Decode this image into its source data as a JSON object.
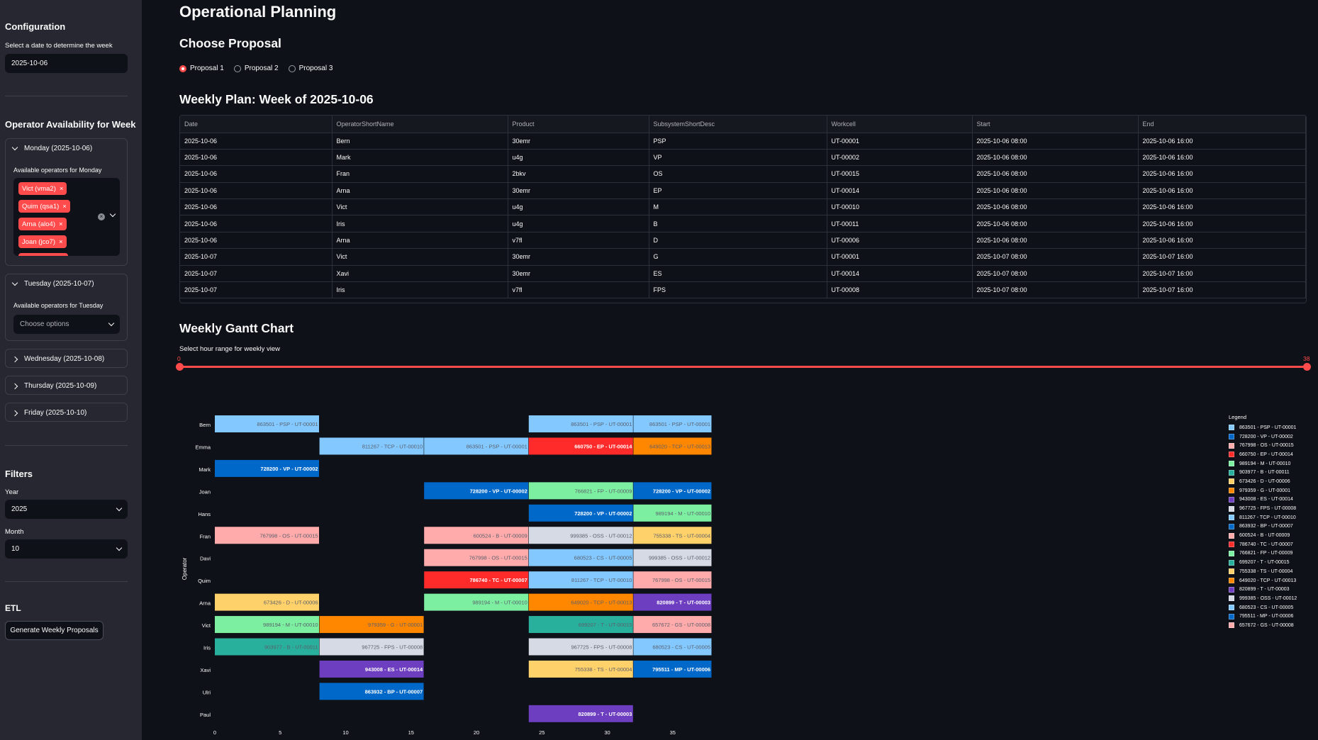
{
  "sidebar": {
    "config_title": "Configuration",
    "date_label": "Select a date to determine the week",
    "date_value": "2025-10-06",
    "avail_title": "Operator Availability for Week",
    "monday": {
      "header": "Monday (2025-10-06)",
      "label": "Available operators for Monday",
      "tags": [
        "Vict (vma2)",
        "Quim (qsa1)",
        "Arna (alo4)",
        "Joan (jco7)"
      ]
    },
    "tuesday": {
      "header": "Tuesday (2025-10-07)",
      "label": "Available operators for Tuesday",
      "placeholder": "Choose options"
    },
    "wednesday": "Wednesday (2025-10-08)",
    "thursday": "Thursday (2025-10-09)",
    "friday": "Friday (2025-10-10)",
    "filters_title": "Filters",
    "year_label": "Year",
    "year_value": "2025",
    "month_label": "Month",
    "month_value": "10",
    "etl_title": "ETL",
    "etl_button": "Generate Weekly Proposals"
  },
  "main": {
    "title": "Operational Planning",
    "proposal_title": "Choose Proposal",
    "proposals": [
      "Proposal 1",
      "Proposal 2",
      "Proposal 3"
    ],
    "selected_proposal": "Proposal 1",
    "plan_title": "Weekly Plan: Week of 2025-10-06",
    "gantt_title": "Weekly Gantt Chart",
    "slider_label": "Select hour range for weekly view",
    "slider_min": "0",
    "slider_max": "38"
  },
  "table": {
    "columns": [
      "Date",
      "OperatorShortName",
      "Product",
      "SubsystemShortDesc",
      "Workcell",
      "Start",
      "End"
    ],
    "rows": [
      [
        "2025-10-06",
        "Bern",
        "30emr",
        "PSP",
        "UT-00001",
        "2025-10-06 08:00",
        "2025-10-06 16:00"
      ],
      [
        "2025-10-06",
        "Mark",
        "u4g",
        "VP",
        "UT-00002",
        "2025-10-06 08:00",
        "2025-10-06 16:00"
      ],
      [
        "2025-10-06",
        "Fran",
        "2bkv",
        "OS",
        "UT-00015",
        "2025-10-06 08:00",
        "2025-10-06 16:00"
      ],
      [
        "2025-10-06",
        "Arna",
        "30emr",
        "EP",
        "UT-00014",
        "2025-10-06 08:00",
        "2025-10-06 16:00"
      ],
      [
        "2025-10-06",
        "Vict",
        "u4g",
        "M",
        "UT-00010",
        "2025-10-06 08:00",
        "2025-10-06 16:00"
      ],
      [
        "2025-10-06",
        "Iris",
        "u4g",
        "B",
        "UT-00011",
        "2025-10-06 08:00",
        "2025-10-06 16:00"
      ],
      [
        "2025-10-06",
        "Arna",
        "v7fl",
        "D",
        "UT-00006",
        "2025-10-06 08:00",
        "2025-10-06 16:00"
      ],
      [
        "2025-10-07",
        "Vict",
        "30emr",
        "G",
        "UT-00001",
        "2025-10-07 08:00",
        "2025-10-07 16:00"
      ],
      [
        "2025-10-07",
        "Xavi",
        "30emr",
        "ES",
        "UT-00014",
        "2025-10-07 08:00",
        "2025-10-07 16:00"
      ],
      [
        "2025-10-07",
        "Iris",
        "v7fl",
        "FPS",
        "UT-00008",
        "2025-10-07 08:00",
        "2025-10-07 16:00"
      ]
    ]
  },
  "colors": {
    "accent": "#ff4b4b",
    "background": "#0e1117",
    "sidebar": "#262730"
  },
  "chart_data": {
    "type": "gantt",
    "ylabel": "Operator",
    "xlim": [
      0,
      38
    ],
    "xticks": [
      0,
      5,
      10,
      15,
      20,
      25,
      30,
      35
    ],
    "operators": [
      "Bern",
      "Emma",
      "Mark",
      "Joan",
      "Hans",
      "Fran",
      "Davi",
      "Quim",
      "Arna",
      "Vict",
      "Iris",
      "Xavi",
      "Ulri",
      "Paul"
    ],
    "legend_title": "Legend",
    "legend": [
      {
        "label": "863501 - PSP - UT-00001",
        "color": "#83c9ff"
      },
      {
        "label": "728200 - VP - UT-00002",
        "color": "#0068c9"
      },
      {
        "label": "767998 - OS - UT-00015",
        "color": "#ffabab"
      },
      {
        "label": "660750 - EP - UT-00014",
        "color": "#ff2b2b"
      },
      {
        "label": "989194 - M - UT-00010",
        "color": "#7defa1"
      },
      {
        "label": "903977 - B - UT-00011",
        "color": "#29b09d"
      },
      {
        "label": "673426 - D - UT-00006",
        "color": "#ffd16a"
      },
      {
        "label": "979359 - G - UT-00001",
        "color": "#ff8700"
      },
      {
        "label": "943008 - ES - UT-00014",
        "color": "#6d3fc0"
      },
      {
        "label": "967725 - FPS - UT-00008",
        "color": "#d5dae5"
      },
      {
        "label": "811267 - TCP - UT-00010",
        "color": "#83c9ff"
      },
      {
        "label": "863932 - BP - UT-00007",
        "color": "#0068c9"
      },
      {
        "label": "600524 - B - UT-00009",
        "color": "#ffabab"
      },
      {
        "label": "786740 - TC - UT-00007",
        "color": "#ff2b2b"
      },
      {
        "label": "766821 - FP - UT-00009",
        "color": "#7defa1"
      },
      {
        "label": "699207 - T - UT-00015",
        "color": "#29b09d"
      },
      {
        "label": "755338 - TS - UT-00004",
        "color": "#ffd16a"
      },
      {
        "label": "649020 - TCP - UT-00013",
        "color": "#ff8700"
      },
      {
        "label": "820899 - T - UT-00003",
        "color": "#6d3fc0"
      },
      {
        "label": "999385 - OSS - UT-00012",
        "color": "#d5dae5"
      },
      {
        "label": "680523 - CS - UT-00005",
        "color": "#83c9ff"
      },
      {
        "label": "795511 - MP - UT-00006",
        "color": "#0068c9"
      },
      {
        "label": "657672 - GS - UT-00008",
        "color": "#ffabab"
      }
    ],
    "tasks": [
      {
        "op": "Bern",
        "start": 0,
        "end": 8,
        "label": "863501 - PSP - UT-00001"
      },
      {
        "op": "Bern",
        "start": 24,
        "end": 32,
        "label": "863501 - PSP - UT-00001"
      },
      {
        "op": "Bern",
        "start": 32,
        "end": 38,
        "label": "863501 - PSP - UT-00001"
      },
      {
        "op": "Emma",
        "start": 8,
        "end": 16,
        "label": "811267 - TCP - UT-00010"
      },
      {
        "op": "Emma",
        "start": 16,
        "end": 24,
        "label": "863501 - PSP - UT-00001"
      },
      {
        "op": "Emma",
        "start": 24,
        "end": 32,
        "label": "660750 - EP - UT-00014"
      },
      {
        "op": "Emma",
        "start": 32,
        "end": 38,
        "label": "649020 - TCP - UT-00013"
      },
      {
        "op": "Mark",
        "start": 0,
        "end": 8,
        "label": "728200 - VP - UT-00002"
      },
      {
        "op": "Joan",
        "start": 16,
        "end": 24,
        "label": "728200 - VP - UT-00002"
      },
      {
        "op": "Joan",
        "start": 24,
        "end": 32,
        "label": "766821 - FP - UT-00009"
      },
      {
        "op": "Joan",
        "start": 32,
        "end": 38,
        "label": "728200 - VP - UT-00002"
      },
      {
        "op": "Hans",
        "start": 24,
        "end": 32,
        "label": "728200 - VP - UT-00002"
      },
      {
        "op": "Hans",
        "start": 32,
        "end": 38,
        "label": "989194 - M - UT-00010"
      },
      {
        "op": "Fran",
        "start": 0,
        "end": 8,
        "label": "767998 - OS - UT-00015"
      },
      {
        "op": "Fran",
        "start": 16,
        "end": 24,
        "label": "600524 - B - UT-00009"
      },
      {
        "op": "Fran",
        "start": 24,
        "end": 32,
        "label": "999385 - OSS - UT-00012"
      },
      {
        "op": "Fran",
        "start": 32,
        "end": 38,
        "label": "755338 - TS - UT-00004"
      },
      {
        "op": "Davi",
        "start": 16,
        "end": 24,
        "label": "767998 - OS - UT-00015"
      },
      {
        "op": "Davi",
        "start": 24,
        "end": 32,
        "label": "680523 - CS - UT-00005"
      },
      {
        "op": "Davi",
        "start": 32,
        "end": 38,
        "label": "999385 - OSS - UT-00012"
      },
      {
        "op": "Quim",
        "start": 16,
        "end": 24,
        "label": "786740 - TC - UT-00007"
      },
      {
        "op": "Quim",
        "start": 24,
        "end": 32,
        "label": "811267 - TCP - UT-00010"
      },
      {
        "op": "Quim",
        "start": 32,
        "end": 38,
        "label": "767998 - OS - UT-00015"
      },
      {
        "op": "Arna",
        "start": 0,
        "end": 8,
        "label": "673426 - D - UT-00006"
      },
      {
        "op": "Arna",
        "start": 16,
        "end": 24,
        "label": "989194 - M - UT-00010"
      },
      {
        "op": "Arna",
        "start": 24,
        "end": 32,
        "label": "649020 - TCP - UT-00013"
      },
      {
        "op": "Arna",
        "start": 32,
        "end": 38,
        "label": "820899 - T - UT-00003"
      },
      {
        "op": "Vict",
        "start": 0,
        "end": 8,
        "label": "989194 - M - UT-00010"
      },
      {
        "op": "Vict",
        "start": 8,
        "end": 16,
        "label": "979359 - G - UT-00001"
      },
      {
        "op": "Vict",
        "start": 24,
        "end": 32,
        "label": "699207 - T - UT-00015"
      },
      {
        "op": "Vict",
        "start": 32,
        "end": 38,
        "label": "657672 - GS - UT-00008"
      },
      {
        "op": "Iris",
        "start": 0,
        "end": 8,
        "label": "903977 - B - UT-00011"
      },
      {
        "op": "Iris",
        "start": 8,
        "end": 16,
        "label": "967725 - FPS - UT-00008"
      },
      {
        "op": "Iris",
        "start": 24,
        "end": 32,
        "label": "967725 - FPS - UT-00008"
      },
      {
        "op": "Iris",
        "start": 32,
        "end": 38,
        "label": "680523 - CS - UT-00005"
      },
      {
        "op": "Xavi",
        "start": 8,
        "end": 16,
        "label": "943008 - ES - UT-00014"
      },
      {
        "op": "Xavi",
        "start": 24,
        "end": 32,
        "label": "755338 - TS - UT-00004"
      },
      {
        "op": "Xavi",
        "start": 32,
        "end": 38,
        "label": "795511 - MP - UT-00006"
      },
      {
        "op": "Ulri",
        "start": 8,
        "end": 16,
        "label": "863932 - BP - UT-00007"
      },
      {
        "op": "Paul",
        "start": 24,
        "end": 32,
        "label": "820899 - T - UT-00003"
      }
    ]
  }
}
